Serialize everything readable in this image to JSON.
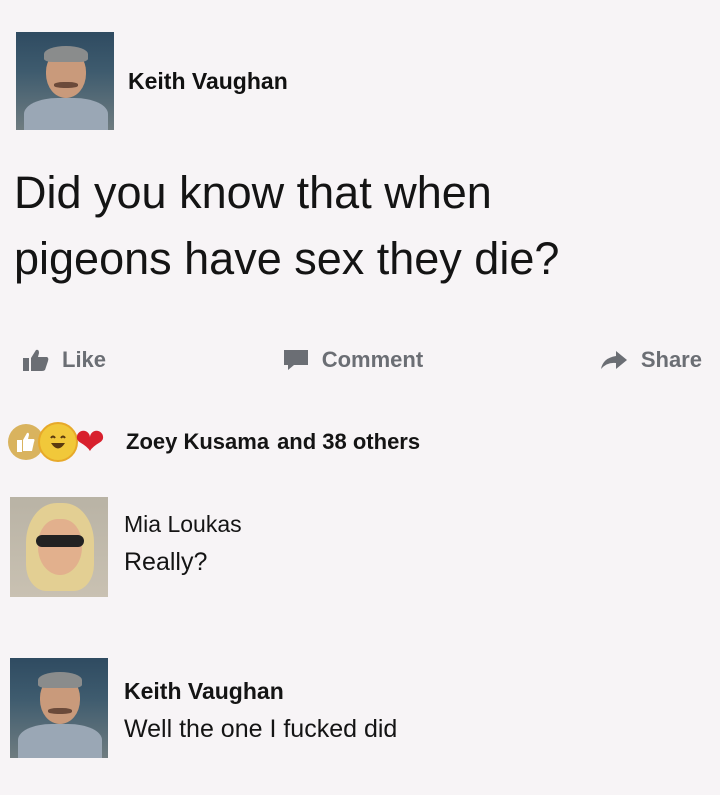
{
  "post": {
    "author": "Keith Vaughan",
    "text_line1": "Did you know that when",
    "text_line2": "pigeons have sex they die?"
  },
  "actions": {
    "like_label": "Like",
    "comment_label": "Comment",
    "share_label": "Share"
  },
  "reactions": {
    "icons": [
      "like-icon",
      "haha-icon",
      "love-icon"
    ],
    "name": "Zoey Kusama",
    "others": "and 38 others"
  },
  "comments": [
    {
      "author": "Mia Loukas",
      "text": "Really?"
    },
    {
      "author": "Keith Vaughan",
      "text": "Well the one I fucked did"
    }
  ],
  "colors": {
    "background": "#f7f4f6",
    "action_gray": "#6b6e74",
    "love_red": "#d8202d"
  }
}
